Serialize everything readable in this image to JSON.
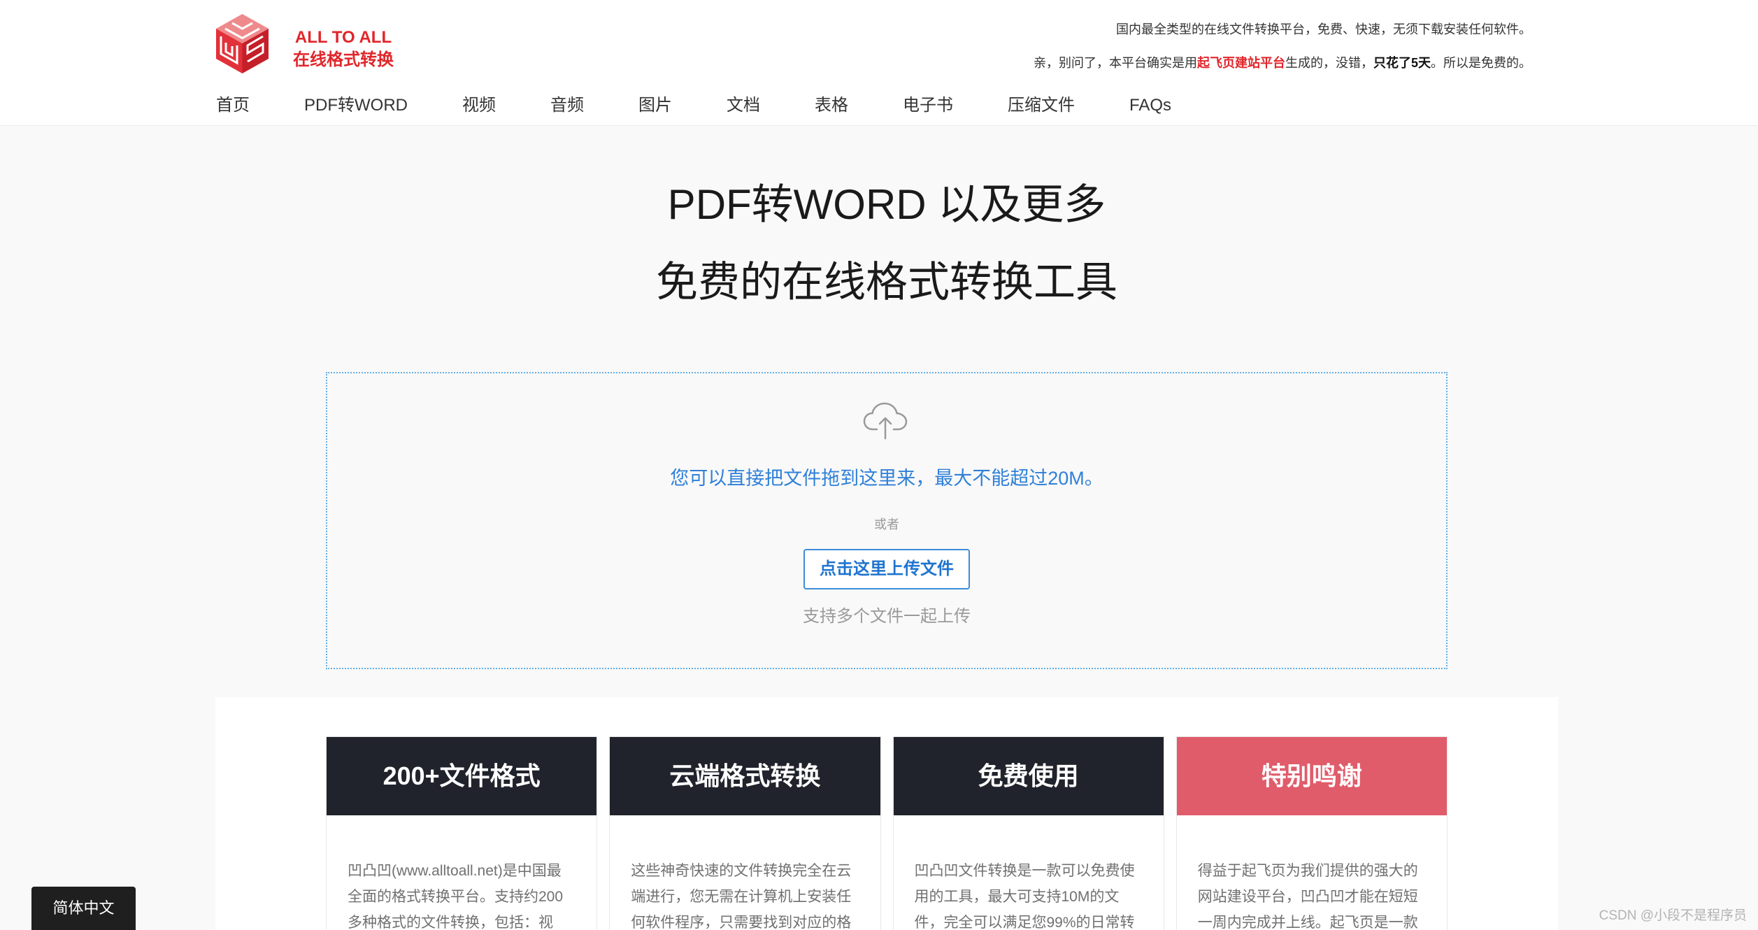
{
  "colors": {
    "brand_red": "#e0262b",
    "link_blue": "#2f80d8",
    "dropzone_border": "#64aee6",
    "dark_header": "#20232b",
    "thanks_header": "#e05c6b",
    "page_bg": "#f9f9f9"
  },
  "header": {
    "logo": {
      "icon": "cube-logo-icon",
      "title": "ALL TO ALL",
      "subtitle": "在线格式转换"
    },
    "tagline": "国内最全类型的在线文件转换平台，免费、快速，无须下载安装任何软件。",
    "note": {
      "prefix": "亲，别问了，本平台确实是用",
      "platform_link": "起飞页建站平台",
      "middle": "生成的，没错，",
      "emphasis": "只花了5天",
      "suffix": "。所以是免费的。"
    }
  },
  "nav": {
    "items": [
      "首页",
      "PDF转WORD",
      "视频",
      "音频",
      "图片",
      "文档",
      "表格",
      "电子书",
      "压缩文件",
      "FAQs"
    ]
  },
  "hero": {
    "title": "PDF转WORD 以及更多",
    "subtitle": "免费的在线格式转换工具"
  },
  "upload": {
    "icon": "cloud-upload-icon",
    "drop_text": "您可以直接把文件拖到这里来，最大不能超过20M。",
    "or_text": "或者",
    "button_label": "点击这里上传文件",
    "hint": "支持多个文件一起上传"
  },
  "features": [
    {
      "title": "200+文件格式",
      "header_color": "#20232b",
      "lines": [
        "凹凸凹(www.alltoall.net)是中国最",
        "全面的格式转换平台。支持约200",
        "多种格式的文件转换，包括：视"
      ]
    },
    {
      "title": "云端格式转换",
      "header_color": "#20232b",
      "lines": [
        "这些神奇快速的文件转换完全在云",
        "端进行，您无需在计算机上安装任",
        "何软件程序，只需要找到对应的格"
      ]
    },
    {
      "title": "免费使用",
      "header_color": "#20232b",
      "lines": [
        "凹凸凹文件转换是一款可以免费使",
        "用的工具，最大可支持10M的文",
        "件，完全可以满足您99%的日常转"
      ]
    },
    {
      "title": "特别鸣谢",
      "header_color": "#e05c6b",
      "lines": [
        "得益于起飞页为我们提供的强大的",
        "网站建设平台，凹凸凹才能在短短",
        "一周内完成并上线。起飞页是一款"
      ]
    }
  ],
  "language_selector": {
    "label": "简体中文"
  },
  "watermark": "CSDN @小段不是程序员"
}
